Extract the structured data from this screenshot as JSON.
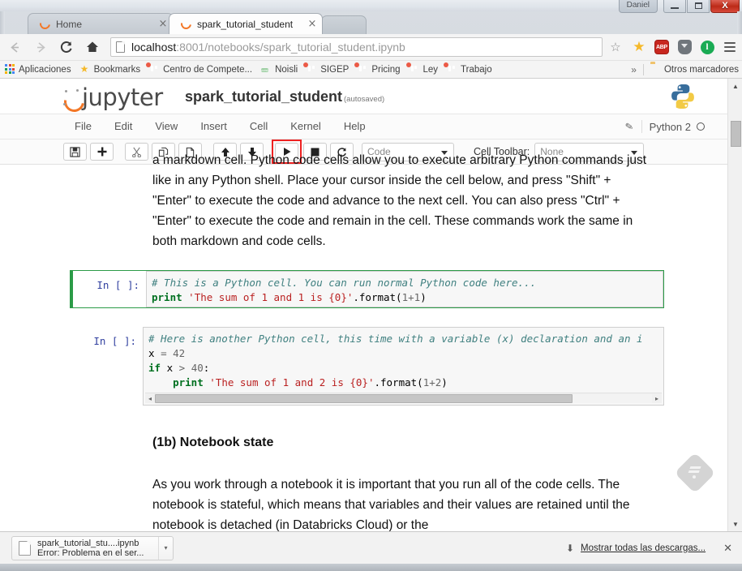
{
  "window": {
    "user_label": "Daniel",
    "minimize": "–",
    "maximize": "□",
    "close": "✕"
  },
  "browser": {
    "tabs": [
      {
        "title": "Home",
        "favicon": "jupyter-circle-icon",
        "active": false,
        "close": "×"
      },
      {
        "title": "spark_tutorial_student",
        "favicon": "jupyter-circle-icon",
        "active": true,
        "close": "×"
      }
    ],
    "nav": {
      "back": "←",
      "forward": "→",
      "reload": "⟳",
      "home": "⌂"
    },
    "omnibox": {
      "host": "localhost",
      "path": ":8001/notebooks/spark_tutorial_student.ipynb",
      "full_url": "localhost:8001/notebooks/spark_tutorial_student.ipynb",
      "star": "☆"
    },
    "extensions": [
      {
        "name": "bookmark-star-icon",
        "label": "★"
      },
      {
        "name": "adblock-plus-icon",
        "label": "ABP"
      },
      {
        "name": "shield-down-icon",
        "label": ""
      },
      {
        "name": "pocket-icon",
        "label": "l"
      },
      {
        "name": "chrome-menu-icon",
        "label": ""
      }
    ],
    "bookmarks": [
      {
        "label": "Aplicaciones",
        "icon": "apps-grid-icon"
      },
      {
        "label": "Bookmarks",
        "icon": "star-icon"
      },
      {
        "label": "Centro de Compete...",
        "icon": "trello-icon"
      },
      {
        "label": "Noisli",
        "icon": "noisli-icon"
      },
      {
        "label": "SIGEP",
        "icon": "trello-icon"
      },
      {
        "label": "Pricing",
        "icon": "trello-icon"
      },
      {
        "label": "Ley",
        "icon": "trello-icon"
      },
      {
        "label": "Trabajo",
        "icon": "trello-icon"
      }
    ],
    "bookmarks_overflow": "»",
    "other_bookmarks": "Otros marcadores"
  },
  "jupyter": {
    "logo_text": "jupyter",
    "notebook_name": "spark_tutorial_student",
    "autosave_label": "(autosaved)",
    "menus": [
      "File",
      "Edit",
      "View",
      "Insert",
      "Cell",
      "Kernel",
      "Help"
    ],
    "kernel_name": "Python 2",
    "edit_pencil": "✎",
    "toolbar": {
      "buttons": [
        {
          "name": "save-button",
          "glyph": "💾"
        },
        {
          "name": "insert-cell-button",
          "glyph": "➕"
        },
        {
          "name": "cut-cell-button",
          "glyph": "✂"
        },
        {
          "name": "copy-cell-button",
          "glyph": "⧉"
        },
        {
          "name": "paste-cell-button",
          "glyph": "📄"
        },
        {
          "name": "move-cell-up-button",
          "glyph": "↑"
        },
        {
          "name": "move-cell-down-button",
          "glyph": "↓"
        },
        {
          "name": "run-cell-button",
          "glyph": "▶"
        },
        {
          "name": "interrupt-kernel-button",
          "glyph": "■"
        },
        {
          "name": "restart-kernel-button",
          "glyph": "⟳"
        }
      ],
      "cell_type_value": "Code",
      "cell_toolbar_label": "Cell Toolbar:",
      "cell_toolbar_value": "None",
      "highlight_color": "#ee2222",
      "highlighted_button": "run-cell-button"
    }
  },
  "notebook": {
    "markdown_top": "a markdown cell. Python code cells allow you to execute arbitrary Python commands just like in any Python shell. Place your cursor inside the cell below, and press \"Shift\" + \"Enter\" to execute the code and advance to the next cell. You can also press \"Ctrl\" + \"Enter\" to execute the code and remain in the cell. These commands work the same in both markdown and code cells.",
    "cells": [
      {
        "prompt": "In [ ]:",
        "selected": true,
        "lines": [
          [
            {
              "t": "# This is a Python cell. You can run normal Python code here...",
              "c": "com"
            }
          ],
          [
            {
              "t": "print",
              "c": "kw"
            },
            {
              "t": " ",
              "c": ""
            },
            {
              "t": "'The sum of 1 and 1 is {0}'",
              "c": "str"
            },
            {
              "t": ".format(",
              "c": "fn"
            },
            {
              "t": "1",
              "c": "num"
            },
            {
              "t": "+",
              "c": "op"
            },
            {
              "t": "1",
              "c": "num"
            },
            {
              "t": ")",
              "c": "fn"
            }
          ]
        ],
        "has_hscroll": false
      },
      {
        "prompt": "In [ ]:",
        "selected": false,
        "lines": [
          [
            {
              "t": "# Here is another Python cell, this time with a variable (x) declaration and an i",
              "c": "com"
            }
          ],
          [
            {
              "t": "x ",
              "c": ""
            },
            {
              "t": "=",
              "c": "op"
            },
            {
              "t": " ",
              "c": ""
            },
            {
              "t": "42",
              "c": "num"
            }
          ],
          [
            {
              "t": "if",
              "c": "kw"
            },
            {
              "t": " x ",
              "c": ""
            },
            {
              "t": ">",
              "c": "op"
            },
            {
              "t": " ",
              "c": ""
            },
            {
              "t": "40",
              "c": "num"
            },
            {
              "t": ":",
              "c": ""
            }
          ],
          [
            {
              "t": "    ",
              "c": ""
            },
            {
              "t": "print",
              "c": "kw"
            },
            {
              "t": " ",
              "c": ""
            },
            {
              "t": "'The sum of 1 and 2 is {0}'",
              "c": "str"
            },
            {
              "t": ".format(",
              "c": "fn"
            },
            {
              "t": "1",
              "c": "num"
            },
            {
              "t": "+",
              "c": "op"
            },
            {
              "t": "2",
              "c": "num"
            },
            {
              "t": ")",
              "c": "fn"
            }
          ]
        ],
        "has_hscroll": true,
        "hscroll_left": "◂",
        "hscroll_right": "▸"
      }
    ],
    "heading_1b": "(1b) Notebook state",
    "markdown_bottom": "As you work through a notebook it is important that you run all of the code cells. The notebook is stateful, which means that variables and their values are retained until the notebook is detached (in Databricks Cloud) or the"
  },
  "floating": {
    "feedly_name": "feedly-button"
  },
  "scrollbar": {
    "up_arrow": "▲",
    "down_arrow": "▼"
  },
  "downloads": {
    "file_name": "spark_tutorial_stu....ipynb",
    "status": "Error: Problema en el ser...",
    "menu_caret": "▾",
    "down_arrow": "⬇",
    "show_all": "Mostrar todas las descargas...",
    "close": "✕"
  },
  "colors": {
    "jupyter_orange": "#f37726",
    "selected_cell_green": "#2b9b47",
    "highlight_red": "#ee2222",
    "prompt_blue": "#303F9F",
    "string_red": "#BA2121",
    "comment_teal": "#408080",
    "keyword_green": "#007020"
  }
}
